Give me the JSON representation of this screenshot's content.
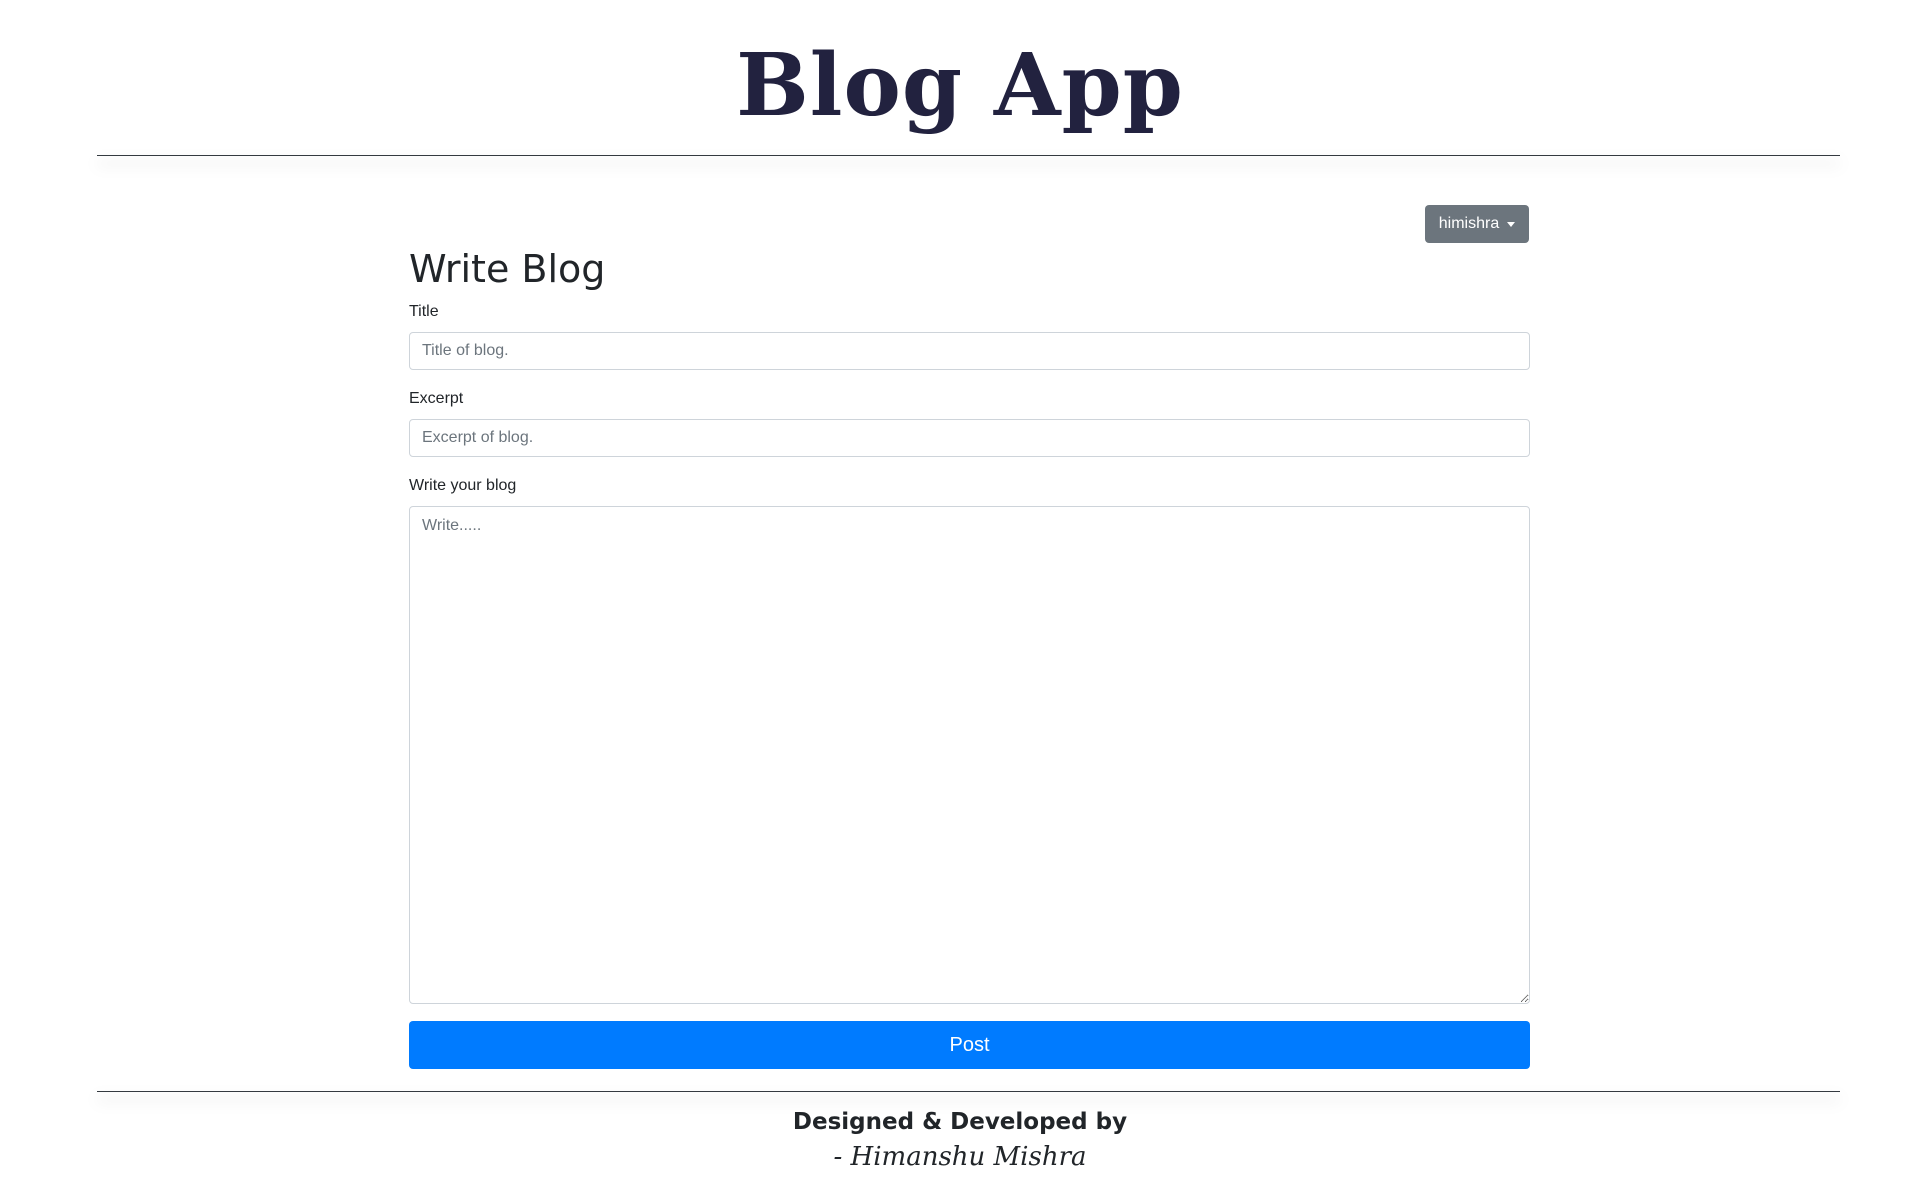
{
  "header": {
    "app_title": "Blog App"
  },
  "user_menu": {
    "username": "himishra"
  },
  "form": {
    "heading": "Write Blog",
    "title_label": "Title",
    "title_placeholder": "Title of blog.",
    "title_value": "",
    "excerpt_label": "Excerpt",
    "excerpt_placeholder": "Excerpt of blog.",
    "excerpt_value": "",
    "body_label": "Write your blog",
    "body_placeholder": "Write.....",
    "body_value": "",
    "submit_label": "Post"
  },
  "footer": {
    "credit": "Designed & Developed by",
    "author": "- Himanshu Mishra"
  },
  "colors": {
    "primary": "#007bff",
    "secondary": "#6c757d",
    "title": "#22223f"
  }
}
